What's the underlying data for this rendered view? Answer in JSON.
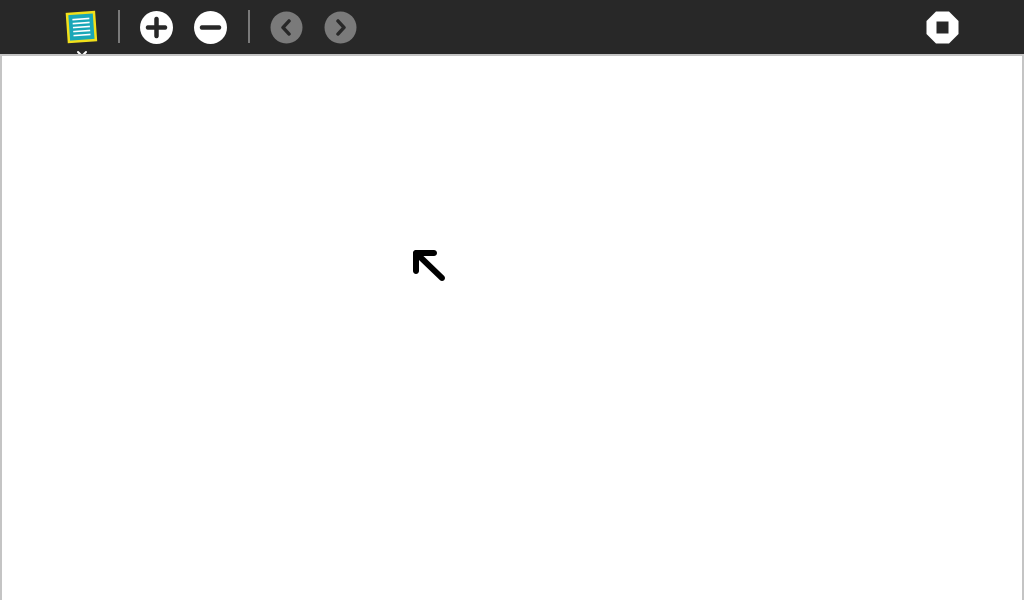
{
  "toolbar": {
    "background": "#282828",
    "buttons": [
      {
        "name": "activity-icon",
        "colors": {
          "fill": "#1aa7b8",
          "border": "#f2e01a",
          "lines": "#ffffff"
        }
      },
      {
        "name": "zoom-in-icon"
      },
      {
        "name": "zoom-out-icon"
      },
      {
        "name": "previous-icon",
        "state": "disabled"
      },
      {
        "name": "next-icon",
        "state": "disabled"
      },
      {
        "name": "stop-icon"
      }
    ]
  },
  "canvas": {
    "background": "#ffffff",
    "cursor": "arrow-up-left-icon"
  }
}
